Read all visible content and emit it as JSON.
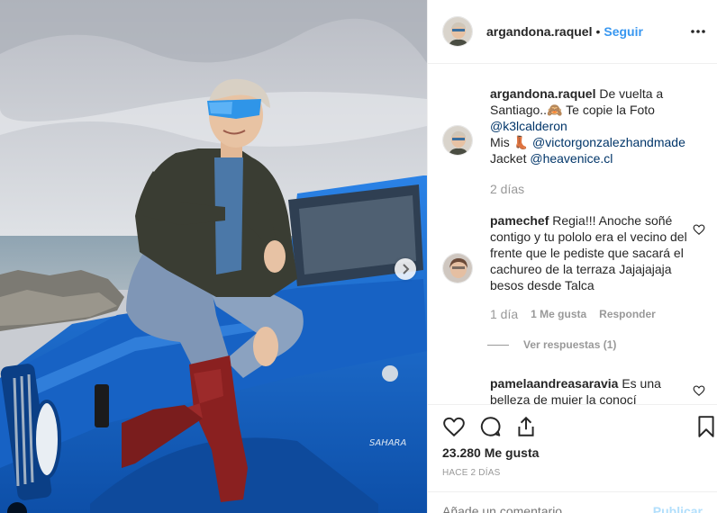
{
  "post": {
    "username": "argandona.raquel",
    "follow_label": "Seguir",
    "separator": "•"
  },
  "caption": {
    "username": "argandona.raquel",
    "line1": "De vuelta a",
    "line2": "Santiago..",
    "line2_rest": " Te copie la Foto",
    "mention1": "@k3lcalderon",
    "mis": "Mis",
    "mention2": "@victorgonzalezhandmade",
    "jacket": "Jacket",
    "mention3": "@heavenice.cl",
    "time": "2 días"
  },
  "comments": [
    {
      "username": "pamechef",
      "text": "Regia!!! Anoche soñé contigo y tu pololo era el vecino del frente que le pediste que sacará el cachureo de la terraza Jajajajaja besos desde Talca",
      "time": "1 día",
      "likes": "1 Me gusta",
      "reply_label": "Responder",
      "view_replies": "Ver respuestas (1)"
    },
    {
      "username": "pamelaandreasaravia",
      "text": "Es una belleza de mujer la conocí"
    }
  ],
  "footer": {
    "likes": "23.280 Me gusta",
    "date": "HACE 2 DÍAS",
    "comment_placeholder": "Añade un comentario...",
    "publish_label": "Publicar"
  },
  "icons": {
    "heart": "heart-icon",
    "comment": "comment-icon",
    "share": "share-icon",
    "save": "bookmark-icon",
    "more": "more-icon",
    "next": "chevron-right-icon"
  },
  "colors": {
    "link": "#3897f0",
    "mention": "#003569",
    "muted": "#999999",
    "text": "#262626",
    "jeep": "#1f6fd6"
  }
}
